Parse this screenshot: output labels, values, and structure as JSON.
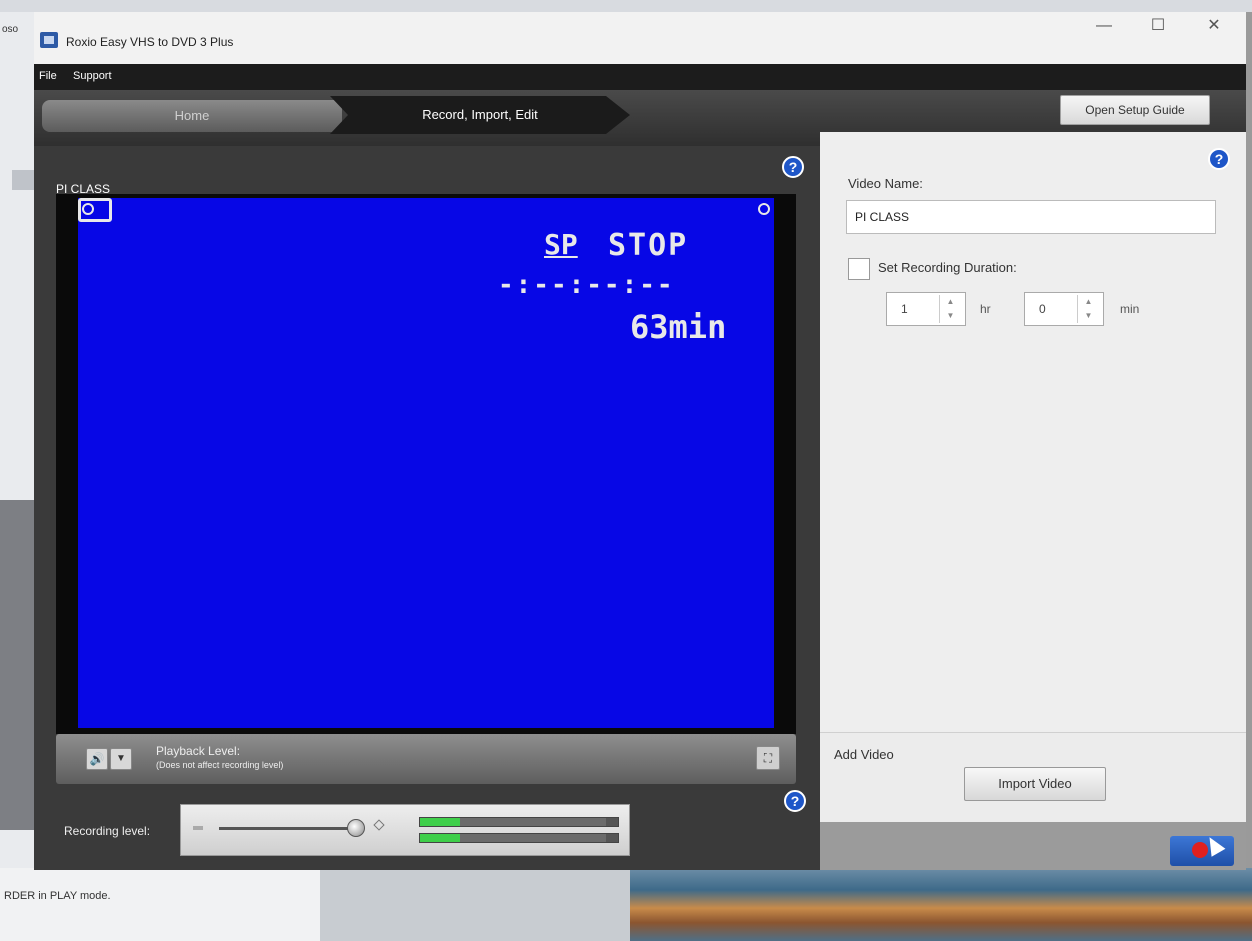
{
  "window": {
    "title": "Roxio Easy VHS to DVD 3 Plus",
    "controls": {
      "minimize": "—",
      "maximize": "☐",
      "close": "✕"
    }
  },
  "menu": {
    "file": "File",
    "support": "Support"
  },
  "nav": {
    "home": "Home",
    "active_step": "Record, Import, Edit",
    "setup_guide": "Open Setup Guide"
  },
  "video_panel": {
    "title": "PI CLASS",
    "osd": {
      "mode": "SP",
      "status": "STOP",
      "time": "-:--:--:--",
      "remaining": "63min"
    },
    "playback_label": "Playback Level:",
    "playback_note": "(Does not affect recording level)",
    "speaker_icon": "speaker-icon",
    "recording_label": "Recording level:"
  },
  "settings": {
    "video_name_label": "Video Name:",
    "video_name_value": "PI CLASS",
    "duration_label": "Set Recording Duration:",
    "hours_value": "1",
    "hours_unit": "hr",
    "minutes_value": "0",
    "minutes_unit": "min",
    "add_video_label": "Add Video",
    "import_button": "Import Video"
  },
  "desktop": {
    "bottom_text": "RDER in PLAY mode.",
    "top_left_text": "oso"
  },
  "colors": {
    "video_blue": "#0707e6",
    "accent_blue": "#1e56c8",
    "record_red": "#e02020"
  }
}
